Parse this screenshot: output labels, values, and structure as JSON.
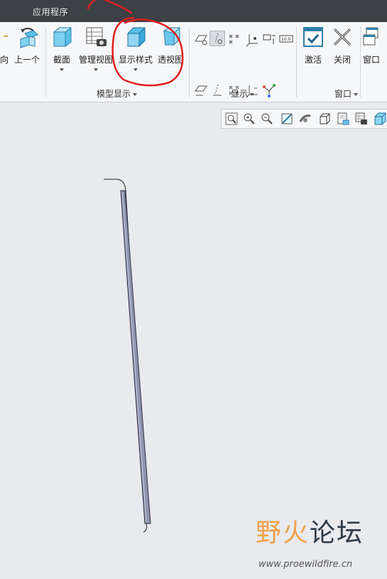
{
  "tabbar": {
    "active_tab": "应用程序"
  },
  "ribbon": {
    "orientation_group": {
      "partial_label": "向",
      "previous_label": "上一个"
    },
    "model_display_group": {
      "label": "模型显示",
      "buttons": {
        "section": "截面",
        "manage_views": "管理视图",
        "display_style": "显示样式",
        "perspective": "透视图"
      }
    },
    "show_group": {
      "label": "显示"
    },
    "window_group": {
      "label": "窗口",
      "buttons": {
        "activate": "激活",
        "close": "关闭",
        "window": "窗口"
      }
    }
  },
  "view_toolbar": {
    "icons": [
      "zoom-fit-icon",
      "zoom-in-icon",
      "zoom-out-icon",
      "repaint-icon",
      "spin-center-icon",
      "saved-orientation-icon",
      "named-views-icon",
      "display-style-icon",
      "appearance-icon"
    ]
  },
  "watermark": {
    "title_part1": "野火",
    "title_part2": "论坛",
    "url": "www.proewildfire.cn"
  },
  "colors": {
    "tabbar_bg": "#3b4144",
    "ribbon_bg": "#f6f7f9",
    "canvas_bg": "#e8eaee",
    "annotation_red": "#e02020",
    "watermark_orange": "#f2a04a"
  }
}
